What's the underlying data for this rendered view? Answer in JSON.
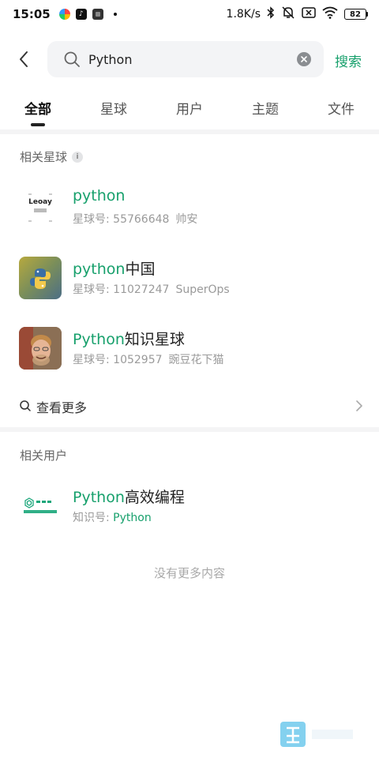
{
  "status_bar": {
    "time": "15:05",
    "network_speed": "1.8K/s",
    "battery": "82",
    "app_icons": [
      "colorful-app-icon",
      "tiktok-icon",
      "app-icon",
      "notification-dot"
    ],
    "system_icons": [
      "bluetooth-icon",
      "mute-icon",
      "sim-off-icon",
      "wifi-icon",
      "battery-icon"
    ]
  },
  "search": {
    "value": "Python",
    "submit_label": "搜索"
  },
  "tabs": [
    {
      "label": "全部",
      "active": true
    },
    {
      "label": "星球",
      "active": false
    },
    {
      "label": "用户",
      "active": false
    },
    {
      "label": "主题",
      "active": false
    },
    {
      "label": "文件",
      "active": false
    }
  ],
  "planets_section": {
    "title": "相关星球",
    "info_badge": "i",
    "items": [
      {
        "title_hl": "python",
        "title_rest": "",
        "id_label": "星球号: 55766648",
        "owner": "帅安"
      },
      {
        "title_hl": "python",
        "title_rest": "中国",
        "id_label": "星球号: 11027247",
        "owner": "SuperOps"
      },
      {
        "title_hl": "Python",
        "title_rest": "知识星球",
        "id_label": "星球号: 1052957",
        "owner": "豌豆花下猫"
      }
    ],
    "view_more": "查看更多"
  },
  "users_section": {
    "title": "相关用户",
    "items": [
      {
        "title_hl": "Python",
        "title_rest": "高效编程",
        "id_prefix": "知识号: ",
        "id_hl": "Python"
      }
    ]
  },
  "footer": {
    "no_more": "没有更多内容"
  },
  "colors": {
    "accent": "#17a06c",
    "secondary_text": "#9a9a9a",
    "divider": "#f4f4f5"
  }
}
